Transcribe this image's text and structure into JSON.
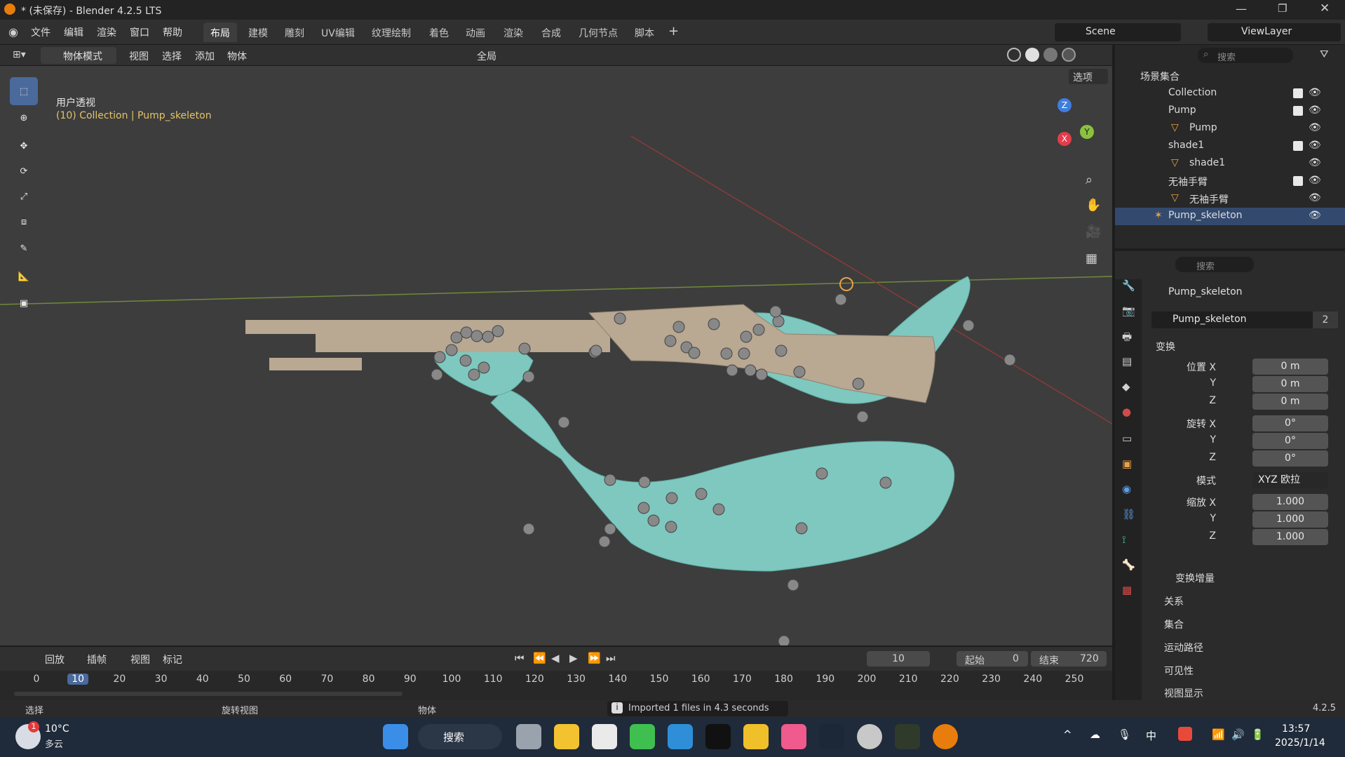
{
  "window": {
    "title": "* (未保存) - Blender 4.2.5 LTS"
  },
  "menu": {
    "items": [
      "文件",
      "编辑",
      "渲染",
      "窗口",
      "帮助"
    ]
  },
  "workspaces": [
    "布局",
    "建模",
    "雕刻",
    "UV编辑",
    "纹理绘制",
    "着色",
    "动画",
    "渲染",
    "合成",
    "几何节点",
    "脚本"
  ],
  "scene": {
    "label": "Scene",
    "view_layer": "ViewLayer"
  },
  "viewport_header": {
    "mode": "物体模式",
    "menus": [
      "视图",
      "选择",
      "添加",
      "物体"
    ],
    "orientation": "全局",
    "options": "选项"
  },
  "viewport": {
    "view_name": "用户透视",
    "context": "(10) Collection | Pump_skeleton"
  },
  "gizmo": {
    "z": "Z",
    "x": "X",
    "y": "Y"
  },
  "outliner": {
    "search_placeholder": "搜索",
    "rows": [
      "场景集合",
      "Collection",
      "Pump",
      "Pump",
      "shade1",
      "shade1",
      "无袖手臂",
      "无袖手臂",
      "Pump_skeleton"
    ]
  },
  "properties": {
    "search_placeholder": "搜索",
    "object_name": "Pump_skeleton",
    "datablock_name": "Pump_skeleton",
    "users": "2",
    "transform_title": "变换",
    "location_label": "位置 X",
    "loc": [
      "0 m",
      "0 m",
      "0 m"
    ],
    "rotation_label": "旋转 X",
    "rot": [
      "0°",
      "0°",
      "0°"
    ],
    "mode_label": "模式",
    "mode_value": "XYZ 欧拉",
    "scale_label": "缩放 X",
    "scale": [
      "1.000",
      "1.000",
      "1.000"
    ],
    "axis_y": "Y",
    "axis_z": "Z",
    "subpanels": [
      "变换增量",
      "关系",
      "集合",
      "运动路径",
      "可见性",
      "视图显示"
    ]
  },
  "timeline": {
    "menus": [
      "回放",
      "插帧",
      "视图",
      "标记"
    ],
    "current_frame": "10",
    "start_label": "起始",
    "start": "0",
    "end_label": "结束",
    "end": "720",
    "ticks": [
      "0",
      "10",
      "20",
      "30",
      "40",
      "50",
      "60",
      "70",
      "80",
      "90",
      "100",
      "110",
      "120",
      "130",
      "140",
      "150",
      "160",
      "170",
      "180",
      "190",
      "200",
      "210",
      "220",
      "230",
      "240",
      "250"
    ],
    "current_frame_value": 10
  },
  "status": {
    "select": "选择",
    "rotate": "旋转视图",
    "object": "物体",
    "message": "Imported 1 files in 4.3 seconds",
    "version": "4.2.5"
  },
  "taskbar": {
    "weather_temp": "10°C",
    "weather_desc": "多云",
    "weather_badge": "1",
    "search": "搜索",
    "time": "13:57",
    "date": "2025/1/14",
    "ime": "中"
  },
  "colors": {
    "accent": "#4a6a9c",
    "mesh": "#7ec8bf",
    "gun": "#b9a892",
    "orange": "#e8a14a"
  }
}
